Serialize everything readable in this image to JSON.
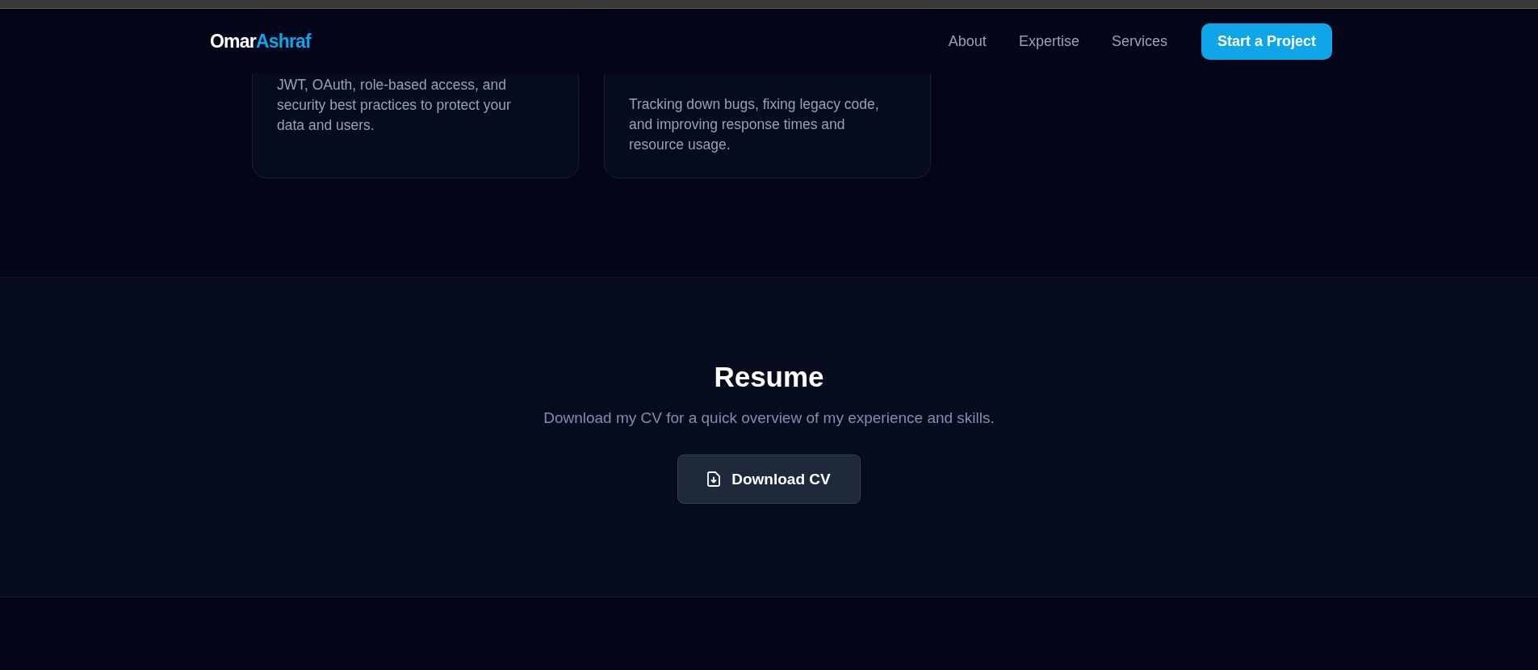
{
  "navbar": {
    "logo": {
      "first": "Omar",
      "second": "Ashraf"
    },
    "links": [
      "About",
      "Expertise",
      "Services"
    ],
    "cta": "Start a Project"
  },
  "cards": [
    {
      "description": "JWT, OAuth, role-based access, and security best practices to protect your data and users."
    },
    {
      "description": "Tracking down bugs, fixing legacy code, and improving response times and resource usage."
    }
  ],
  "resume": {
    "title": "Resume",
    "subtitle": "Download my CV for a quick overview of my experience and skills.",
    "button": "Download CV"
  }
}
